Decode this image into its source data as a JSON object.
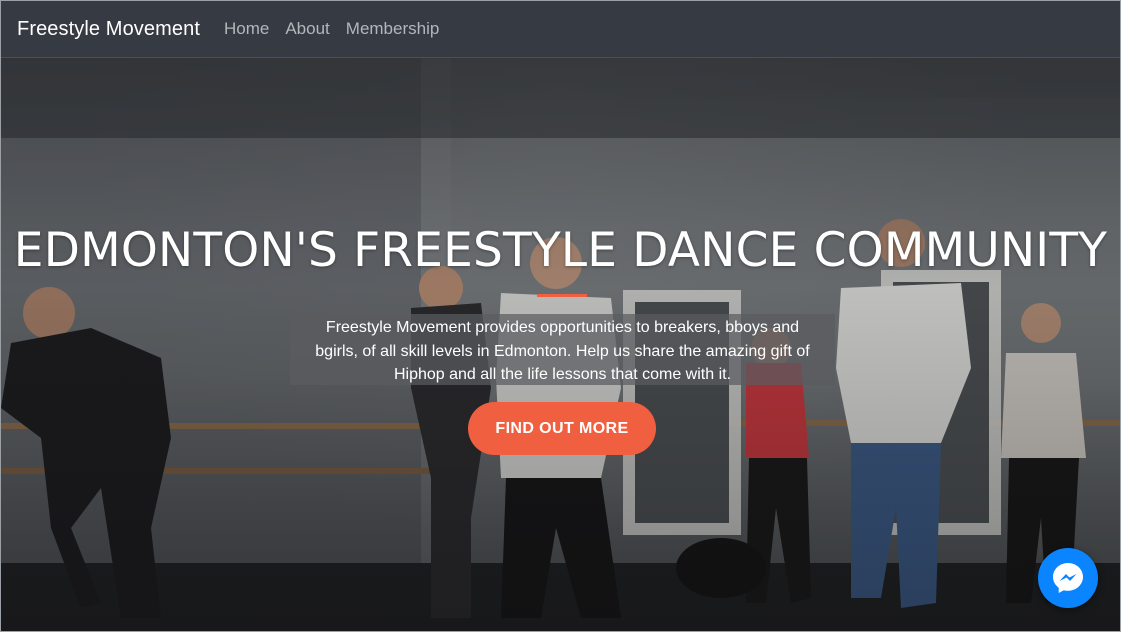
{
  "navbar": {
    "brand": "Freestyle Movement",
    "links": [
      {
        "label": "Home"
      },
      {
        "label": "About"
      },
      {
        "label": "Membership"
      }
    ]
  },
  "hero": {
    "title": "EDMONTON'S FREESTYLE DANCE COMMUNITY",
    "description": "Freestyle Movement provides opportunities to breakers, bboys and bgirls, of all skill levels in Edmonton. Help us share the amazing gift of Hiphop and all the life lessons that come with it.",
    "cta_label": "FIND OUT MORE"
  },
  "colors": {
    "accent": "#f05f40",
    "navbar": "#363a42",
    "messenger": "#0a84ff"
  },
  "icons": {
    "chat": "messenger-icon"
  }
}
